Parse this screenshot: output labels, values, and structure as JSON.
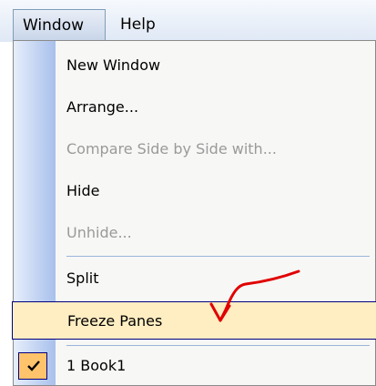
{
  "menubar": {
    "items": [
      {
        "label": "Window"
      },
      {
        "label": "Help"
      }
    ]
  },
  "menu": {
    "items": [
      {
        "label": "New Window",
        "enabled": true
      },
      {
        "label": "Arrange...",
        "enabled": true
      },
      {
        "label": "Compare Side by Side with...",
        "enabled": false
      },
      {
        "label": "Hide",
        "enabled": true
      },
      {
        "label": "Unhide...",
        "enabled": false
      },
      {
        "label": "Split",
        "enabled": true
      },
      {
        "label": "Freeze Panes",
        "enabled": true,
        "highlighted": true
      },
      {
        "label": "1 Book1",
        "enabled": true,
        "checked": true
      }
    ]
  },
  "colors": {
    "highlight_bg": "#ffeec2",
    "highlight_border": "#000080",
    "annotation": "#e00000"
  }
}
